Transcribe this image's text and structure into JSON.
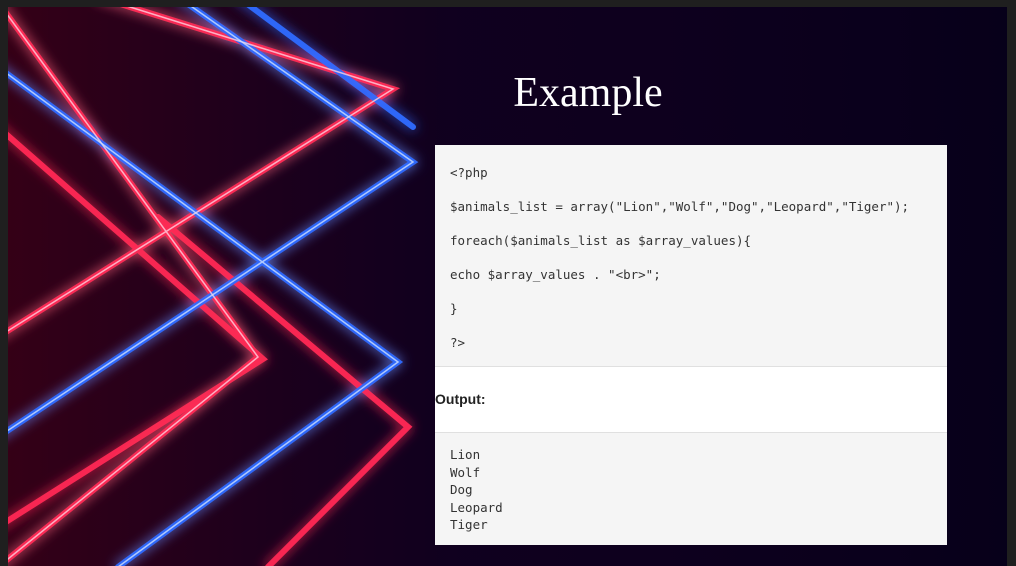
{
  "slide": {
    "title": "Example"
  },
  "code": {
    "lines": [
      "<?php",
      "$animals_list = array(\"Lion\",\"Wolf\",\"Dog\",\"Leopard\",\"Tiger\");",
      "foreach($animals_list as $array_values){",
      "echo $array_values . \"<br>\";",
      "}",
      "?>"
    ]
  },
  "output": {
    "label": "Output:",
    "lines": [
      "Lion",
      "Wolf",
      "Dog",
      "Leopard",
      "Tiger"
    ]
  },
  "colors": {
    "background": "#07001a",
    "neon_red": "#ff2a55",
    "neon_blue": "#2f6bff",
    "panel": "#f5f5f5"
  }
}
